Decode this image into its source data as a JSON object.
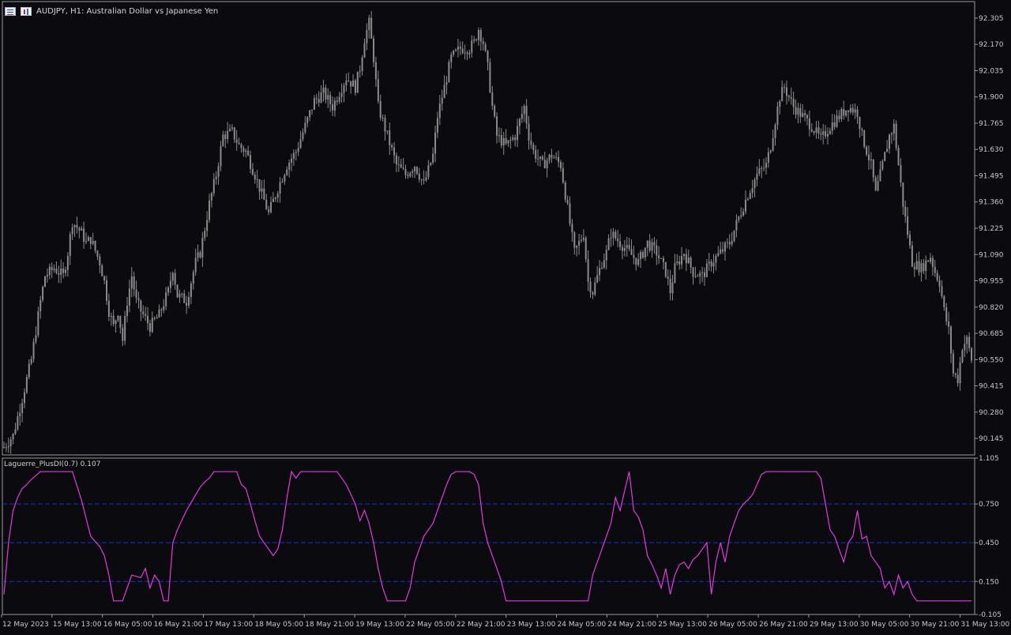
{
  "header": {
    "symbol_line": "AUDJPY, H1:  Australian Dollar vs Japanese Yen",
    "icons": [
      "menu-list-icon",
      "chart-icon"
    ]
  },
  "indicator": {
    "label": "Laguerre_PlusDI(0.7) 0.107",
    "line_color": "#e23be0",
    "level_color": "#1c2fd0"
  },
  "colors": {
    "background": "#0a0a0f",
    "candles": "#8c8c8c",
    "axis_text": "#c8c8c8",
    "frame": "#9a9a9a"
  },
  "chart_data": [
    {
      "type": "candlestick",
      "title": "AUDJPY, H1",
      "ylim": [
        90.06,
        92.39
      ],
      "y_ticks": [
        "92.305",
        "92.170",
        "92.035",
        "91.900",
        "91.765",
        "91.630",
        "91.495",
        "91.360",
        "91.225",
        "91.090",
        "90.955",
        "90.820",
        "90.685",
        "90.550",
        "90.415",
        "90.280",
        "90.145"
      ],
      "close_path": [
        [
          0,
          90.1
        ],
        [
          4,
          90.16
        ],
        [
          8,
          90.35
        ],
        [
          12,
          90.55
        ],
        [
          16,
          90.85
        ],
        [
          18,
          90.98
        ],
        [
          22,
          91.02
        ],
        [
          26,
          90.98
        ],
        [
          28,
          91.1
        ],
        [
          30,
          91.26
        ],
        [
          34,
          91.2
        ],
        [
          36,
          91.15
        ],
        [
          38,
          91.17
        ],
        [
          42,
          91.05
        ],
        [
          44,
          90.95
        ],
        [
          46,
          90.8
        ],
        [
          48,
          90.72
        ],
        [
          50,
          90.8
        ],
        [
          52,
          90.65
        ],
        [
          54,
          90.85
        ],
        [
          56,
          90.98
        ],
        [
          58,
          90.85
        ],
        [
          60,
          90.8
        ],
        [
          64,
          90.72
        ],
        [
          68,
          90.78
        ],
        [
          72,
          90.9
        ],
        [
          74,
          91.02
        ],
        [
          76,
          90.88
        ],
        [
          80,
          90.85
        ],
        [
          84,
          91.05
        ],
        [
          86,
          91.1
        ],
        [
          90,
          91.35
        ],
        [
          93,
          91.5
        ],
        [
          96,
          91.7
        ],
        [
          100,
          91.72
        ],
        [
          103,
          91.65
        ],
        [
          106,
          91.62
        ],
        [
          110,
          91.5
        ],
        [
          113,
          91.4
        ],
        [
          116,
          91.3
        ],
        [
          120,
          91.43
        ],
        [
          124,
          91.55
        ],
        [
          128,
          91.62
        ],
        [
          132,
          91.75
        ],
        [
          136,
          91.88
        ],
        [
          140,
          91.92
        ],
        [
          144,
          91.85
        ],
        [
          148,
          91.95
        ],
        [
          150,
          92.0
        ],
        [
          154,
          91.95
        ],
        [
          156,
          92.05
        ],
        [
          158,
          92.2
        ],
        [
          160,
          92.28
        ],
        [
          162,
          92.1
        ],
        [
          164,
          91.85
        ],
        [
          168,
          91.7
        ],
        [
          172,
          91.55
        ],
        [
          176,
          91.5
        ],
        [
          180,
          91.55
        ],
        [
          184,
          91.45
        ],
        [
          188,
          91.6
        ],
        [
          190,
          91.8
        ],
        [
          194,
          92.0
        ],
        [
          196,
          92.1
        ],
        [
          200,
          92.15
        ],
        [
          204,
          92.15
        ],
        [
          206,
          92.18
        ],
        [
          208,
          92.25
        ],
        [
          210,
          92.18
        ],
        [
          212,
          92.05
        ],
        [
          214,
          91.85
        ],
        [
          216,
          91.7
        ],
        [
          220,
          91.65
        ],
        [
          224,
          91.7
        ],
        [
          228,
          91.85
        ],
        [
          230,
          91.7
        ],
        [
          232,
          91.62
        ],
        [
          236,
          91.55
        ],
        [
          240,
          91.6
        ],
        [
          244,
          91.55
        ],
        [
          246,
          91.4
        ],
        [
          248,
          91.25
        ],
        [
          250,
          91.1
        ],
        [
          254,
          91.2
        ],
        [
          256,
          90.95
        ],
        [
          258,
          90.9
        ],
        [
          262,
          91.05
        ],
        [
          264,
          91.1
        ],
        [
          266,
          91.2
        ],
        [
          270,
          91.15
        ],
        [
          274,
          91.1
        ],
        [
          278,
          91.05
        ],
        [
          282,
          91.15
        ],
        [
          286,
          91.1
        ],
        [
          290,
          91.0
        ],
        [
          292,
          90.9
        ],
        [
          294,
          91.02
        ],
        [
          298,
          91.1
        ],
        [
          302,
          91.0
        ],
        [
          306,
          90.98
        ],
        [
          310,
          91.05
        ],
        [
          314,
          91.1
        ],
        [
          318,
          91.15
        ],
        [
          322,
          91.28
        ],
        [
          326,
          91.4
        ],
        [
          330,
          91.5
        ],
        [
          334,
          91.55
        ],
        [
          336,
          91.65
        ],
        [
          338,
          91.78
        ],
        [
          340,
          91.9
        ],
        [
          342,
          91.95
        ],
        [
          346,
          91.85
        ],
        [
          350,
          91.8
        ],
        [
          354,
          91.75
        ],
        [
          358,
          91.68
        ],
        [
          362,
          91.75
        ],
        [
          366,
          91.8
        ],
        [
          370,
          91.85
        ],
        [
          374,
          91.82
        ],
        [
          376,
          91.7
        ],
        [
          380,
          91.55
        ],
        [
          382,
          91.4
        ],
        [
          384,
          91.5
        ],
        [
          388,
          91.7
        ],
        [
          390,
          91.75
        ],
        [
          392,
          91.55
        ],
        [
          394,
          91.35
        ],
        [
          396,
          91.2
        ],
        [
          398,
          91.05
        ],
        [
          402,
          91.02
        ],
        [
          404,
          91.05
        ],
        [
          406,
          91.08
        ],
        [
          408,
          91.0
        ],
        [
          410,
          90.95
        ],
        [
          412,
          90.8
        ],
        [
          414,
          90.7
        ],
        [
          416,
          90.48
        ],
        [
          418,
          90.45
        ],
        [
          420,
          90.62
        ],
        [
          422,
          90.65
        ],
        [
          424,
          90.55
        ]
      ]
    },
    {
      "type": "line",
      "title": "Laguerre_PlusDI(0.7) 0.107",
      "ylim": [
        -0.105,
        1.105
      ],
      "y_ticks": [
        "1.105",
        "0.750",
        "0.450",
        "0.150",
        "-0.105"
      ],
      "levels": [
        0.75,
        0.45,
        0.15
      ],
      "series": [
        {
          "name": "Laguerre_PlusDI(0.7)",
          "points": [
            [
              0,
              0.05
            ],
            [
              2,
              0.45
            ],
            [
              4,
              0.7
            ],
            [
              6,
              0.8
            ],
            [
              8,
              0.87
            ],
            [
              10,
              0.9
            ],
            [
              12,
              0.94
            ],
            [
              14,
              0.97
            ],
            [
              16,
              1.0
            ],
            [
              18,
              1.0
            ],
            [
              28,
              1.0
            ],
            [
              30,
              1.0
            ],
            [
              34,
              0.78
            ],
            [
              38,
              0.5
            ],
            [
              42,
              0.42
            ],
            [
              44,
              0.35
            ],
            [
              46,
              0.2
            ],
            [
              48,
              0.0
            ],
            [
              52,
              0.0
            ],
            [
              54,
              0.1
            ],
            [
              56,
              0.2
            ],
            [
              60,
              0.18
            ],
            [
              62,
              0.25
            ],
            [
              64,
              0.1
            ],
            [
              66,
              0.2
            ],
            [
              68,
              0.15
            ],
            [
              70,
              0.0
            ],
            [
              72,
              0.0
            ],
            [
              74,
              0.45
            ],
            [
              76,
              0.55
            ],
            [
              80,
              0.7
            ],
            [
              84,
              0.82
            ],
            [
              86,
              0.88
            ],
            [
              88,
              0.92
            ],
            [
              90,
              0.95
            ],
            [
              92,
              1.0
            ],
            [
              102,
              1.0
            ],
            [
              104,
              0.9
            ],
            [
              106,
              0.87
            ],
            [
              108,
              0.75
            ],
            [
              110,
              0.62
            ],
            [
              112,
              0.5
            ],
            [
              114,
              0.45
            ],
            [
              118,
              0.35
            ],
            [
              120,
              0.4
            ],
            [
              122,
              0.55
            ],
            [
              124,
              0.8
            ],
            [
              126,
              1.0
            ],
            [
              128,
              0.95
            ],
            [
              130,
              1.0
            ],
            [
              146,
              1.0
            ],
            [
              150,
              0.9
            ],
            [
              154,
              0.75
            ],
            [
              156,
              0.62
            ],
            [
              158,
              0.7
            ],
            [
              160,
              0.6
            ],
            [
              162,
              0.45
            ],
            [
              164,
              0.25
            ],
            [
              166,
              0.1
            ],
            [
              168,
              0.0
            ],
            [
              176,
              0.0
            ],
            [
              178,
              0.1
            ],
            [
              180,
              0.3
            ],
            [
              182,
              0.4
            ],
            [
              184,
              0.5
            ],
            [
              188,
              0.6
            ],
            [
              190,
              0.7
            ],
            [
              192,
              0.8
            ],
            [
              194,
              0.9
            ],
            [
              196,
              0.98
            ],
            [
              198,
              1.0
            ],
            [
              204,
              1.0
            ],
            [
              206,
              0.98
            ],
            [
              208,
              0.9
            ],
            [
              210,
              0.6
            ],
            [
              212,
              0.45
            ],
            [
              214,
              0.35
            ],
            [
              216,
              0.25
            ],
            [
              218,
              0.15
            ],
            [
              220,
              0.0
            ],
            [
              250,
              0.0
            ],
            [
              256,
              0.0
            ],
            [
              258,
              0.2
            ],
            [
              262,
              0.4
            ],
            [
              266,
              0.6
            ],
            [
              268,
              0.8
            ],
            [
              270,
              0.7
            ],
            [
              272,
              0.85
            ],
            [
              274,
              1.0
            ],
            [
              276,
              0.7
            ],
            [
              278,
              0.65
            ],
            [
              280,
              0.55
            ],
            [
              282,
              0.35
            ],
            [
              284,
              0.28
            ],
            [
              286,
              0.2
            ],
            [
              288,
              0.1
            ],
            [
              290,
              0.25
            ],
            [
              292,
              0.05
            ],
            [
              294,
              0.2
            ],
            [
              296,
              0.28
            ],
            [
              298,
              0.3
            ],
            [
              300,
              0.25
            ],
            [
              302,
              0.32
            ],
            [
              304,
              0.35
            ],
            [
              306,
              0.4
            ],
            [
              308,
              0.45
            ],
            [
              310,
              0.05
            ],
            [
              312,
              0.3
            ],
            [
              314,
              0.45
            ],
            [
              316,
              0.3
            ],
            [
              318,
              0.5
            ],
            [
              320,
              0.6
            ],
            [
              322,
              0.7
            ],
            [
              324,
              0.75
            ],
            [
              326,
              0.78
            ],
            [
              328,
              0.82
            ],
            [
              330,
              0.9
            ],
            [
              332,
              0.98
            ],
            [
              334,
              1.0
            ],
            [
              356,
              1.0
            ],
            [
              358,
              0.95
            ],
            [
              360,
              0.75
            ],
            [
              362,
              0.55
            ],
            [
              364,
              0.5
            ],
            [
              366,
              0.4
            ],
            [
              368,
              0.3
            ],
            [
              370,
              0.45
            ],
            [
              372,
              0.5
            ],
            [
              374,
              0.7
            ],
            [
              376,
              0.48
            ],
            [
              378,
              0.5
            ],
            [
              380,
              0.35
            ],
            [
              382,
              0.3
            ],
            [
              384,
              0.25
            ],
            [
              386,
              0.1
            ],
            [
              388,
              0.15
            ],
            [
              390,
              0.05
            ],
            [
              392,
              0.2
            ],
            [
              394,
              0.1
            ],
            [
              396,
              0.15
            ],
            [
              398,
              0.05
            ],
            [
              400,
              0.0
            ],
            [
              420,
              0.0
            ],
            [
              424,
              0.0
            ]
          ]
        }
      ]
    }
  ],
  "x_axis": {
    "labels": [
      "12 May 2023",
      "15 May 13:00",
      "16 May 05:00",
      "16 May 21:00",
      "17 May 13:00",
      "18 May 05:00",
      "18 May 21:00",
      "19 May 13:00",
      "22 May 05:00",
      "22 May 21:00",
      "23 May 13:00",
      "24 May 05:00",
      "24 May 21:00",
      "25 May 13:00",
      "26 May 05:00",
      "26 May 21:00",
      "29 May 13:00",
      "30 May 05:00",
      "30 May 21:00",
      "31 May 13:00"
    ]
  }
}
